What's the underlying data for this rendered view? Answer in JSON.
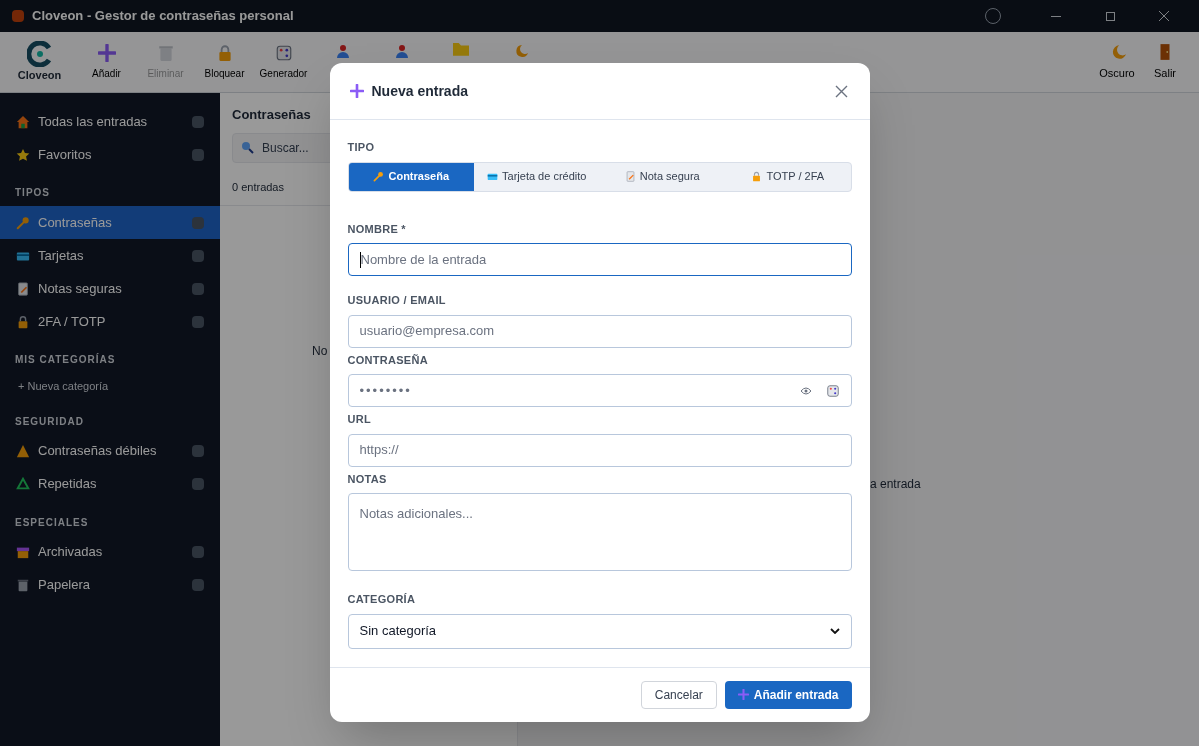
{
  "window": {
    "title": "Cloveon - Gestor de contraseñas personal"
  },
  "toolbar": {
    "logo": "Cloveon",
    "items": [
      {
        "label": "Añadir",
        "disabled": false
      },
      {
        "label": "Eliminar",
        "disabled": true
      },
      {
        "label": "Bloquear",
        "disabled": false
      },
      {
        "label": "Generador",
        "disabled": false
      }
    ],
    "right": [
      {
        "label": "Oscuro"
      },
      {
        "label": "Salir"
      }
    ]
  },
  "sidebar": {
    "sections": [
      {
        "items": [
          {
            "label": "Todas las entradas",
            "selected": false
          },
          {
            "label": "Favoritos",
            "selected": false
          }
        ]
      },
      {
        "title": "TIPOS",
        "items": [
          {
            "label": "Contraseñas",
            "selected": true
          },
          {
            "label": "Tarjetas",
            "selected": false
          },
          {
            "label": "Notas seguras",
            "selected": false
          },
          {
            "label": "2FA / TOTP",
            "selected": false
          }
        ]
      },
      {
        "title": "MIS CATEGORÍAS",
        "action": "+ Nueva categoría"
      },
      {
        "title": "SEGURIDAD",
        "items": [
          {
            "label": "Contraseñas débiles",
            "selected": false
          },
          {
            "label": "Repetidas",
            "selected": false
          }
        ]
      },
      {
        "title": "ESPECIALES",
        "items": [
          {
            "label": "Archivadas",
            "selected": false
          },
          {
            "label": "Papelera",
            "selected": false
          }
        ]
      }
    ]
  },
  "list": {
    "title": "Contraseñas",
    "search_placeholder": "Buscar...",
    "count": "0 entradas",
    "empty_text": "No"
  },
  "main": {
    "empty_text": "a entrada"
  },
  "dialog": {
    "title": "Nueva entrada",
    "type_label": "TIPO",
    "types": [
      {
        "label": "Contraseña",
        "selected": true
      },
      {
        "label": "Tarjeta de crédito",
        "selected": false
      },
      {
        "label": "Nota segura",
        "selected": false
      },
      {
        "label": "TOTP / 2FA",
        "selected": false
      }
    ],
    "fields": [
      {
        "kind": "text",
        "label": "NOMBRE *",
        "placeholder": "Nombre de la entrada",
        "focused": true
      },
      {
        "kind": "text",
        "label": "USUARIO / EMAIL",
        "placeholder": "usuario@empresa.com",
        "focused": false
      },
      {
        "kind": "password",
        "label": "CONTRASEÑA",
        "placeholder": "••••••••",
        "focused": false
      },
      {
        "kind": "text",
        "label": "URL",
        "placeholder": "https://",
        "focused": false
      },
      {
        "kind": "textarea",
        "label": "NOTAS",
        "placeholder": "Notas adicionales...",
        "focused": false
      },
      {
        "kind": "select",
        "label": "CATEGORÍA",
        "value": "Sin categoría",
        "focused": false
      }
    ],
    "buttons": [
      {
        "kind": "secondary",
        "label": "Cancelar"
      },
      {
        "kind": "primary",
        "label": "Añadir entrada"
      }
    ]
  }
}
